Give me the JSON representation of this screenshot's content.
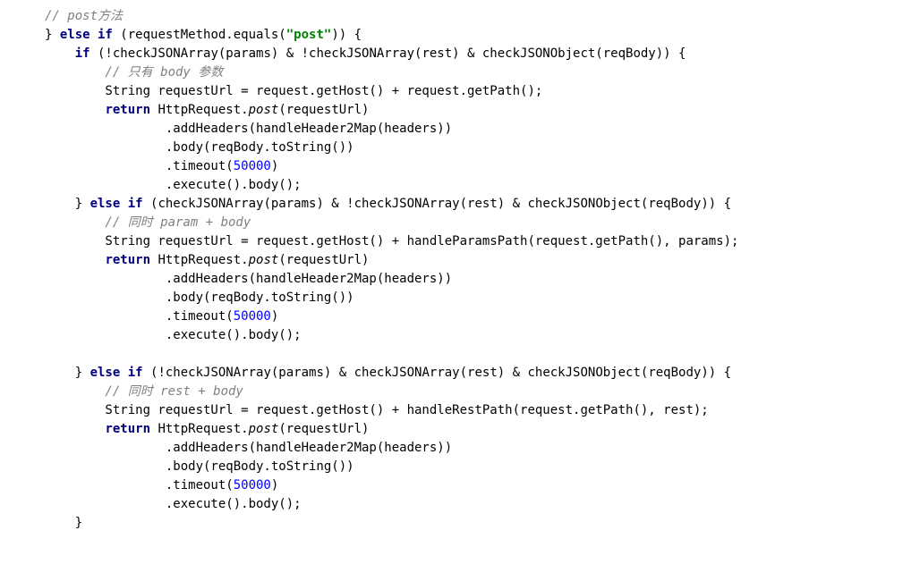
{
  "code": {
    "c1": "// post方法",
    "l2_p1": "} ",
    "l2_else": "else if",
    "l2_p2": " (requestMethod.equals(",
    "l2_str": "\"post\"",
    "l2_p3": ")) {",
    "l3_p1": "    ",
    "l3_if": "if",
    "l3_p2": " (!checkJSONArray(params) & !checkJSONArray(rest) & checkJSONObject(reqBody)) {",
    "c2": "        // 只有 body 参数",
    "l5_p1": "        String requestUrl = request.getHost() + request.getPath();",
    "l6_p1": "        ",
    "l6_ret": "return",
    "l6_p2": " HttpRequest.",
    "l6_post": "post",
    "l6_p3": "(requestUrl)",
    "l7": "                .addHeaders(handleHeader2Map(headers))",
    "l8": "                .body(reqBody.toString())",
    "l9_p1": "                .timeout(",
    "l9_num": "50000",
    "l9_p2": ")",
    "l10": "                .execute().body();",
    "l11_p1": "    } ",
    "l11_else": "else if",
    "l11_p2": " (checkJSONArray(params) & !checkJSONArray(rest) & checkJSONObject(reqBody)) {",
    "c3": "        // 同时 param + body",
    "l13": "        String requestUrl = request.getHost() + handleParamsPath(request.getPath(), params);",
    "l14_p1": "        ",
    "l14_ret": "return",
    "l14_p2": " HttpRequest.",
    "l14_post": "post",
    "l14_p3": "(requestUrl)",
    "l15": "                .addHeaders(handleHeader2Map(headers))",
    "l16": "                .body(reqBody.toString())",
    "l17_p1": "                .timeout(",
    "l17_num": "50000",
    "l17_p2": ")",
    "l18": "                .execute().body();",
    "l19": "",
    "l20_p1": "    } ",
    "l20_else": "else if",
    "l20_p2": " (!checkJSONArray(params) & checkJSONArray(rest) & checkJSONObject(reqBody)) {",
    "c4": "        // 同时 rest + body",
    "l22": "        String requestUrl = request.getHost() + handleRestPath(request.getPath(), rest);",
    "l23_p1": "        ",
    "l23_ret": "return",
    "l23_p2": " HttpRequest.",
    "l23_post": "post",
    "l23_p3": "(requestUrl)",
    "l24": "                .addHeaders(handleHeader2Map(headers))",
    "l25": "                .body(reqBody.toString())",
    "l26_p1": "                .timeout(",
    "l26_num": "50000",
    "l26_p2": ")",
    "l27": "                .execute().body();",
    "l28": "    }"
  }
}
